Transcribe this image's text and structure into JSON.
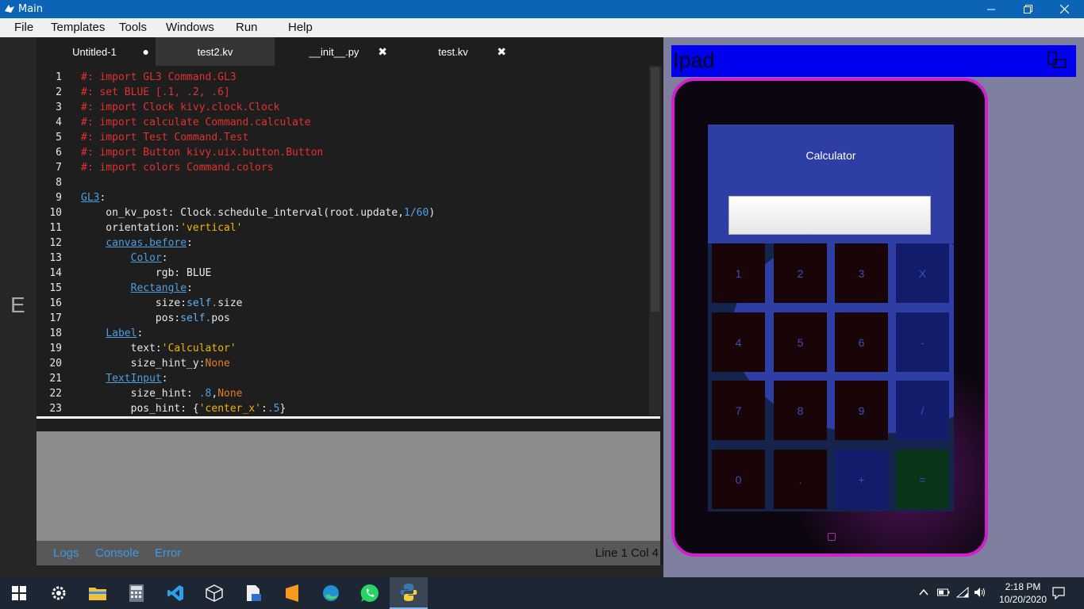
{
  "window": {
    "title": "Main"
  },
  "menu": {
    "items": [
      "File",
      "Templates",
      "Tools",
      "Windows",
      "Run",
      "Help"
    ]
  },
  "tabs": [
    {
      "label": "Untitled-1",
      "mark": "●"
    },
    {
      "label": "test2.kv",
      "mark": ""
    },
    {
      "label": "__init__.py",
      "mark": "✖"
    },
    {
      "label": "test.kv",
      "mark": "✖"
    }
  ],
  "left_strip_letter": "E",
  "code": {
    "line_numbers": [
      "1",
      "2",
      "3",
      "4",
      "5",
      "6",
      "7",
      "8",
      "9",
      "10",
      "11",
      "12",
      "13",
      "14",
      "15",
      "16",
      "17",
      "18",
      "19",
      "20",
      "21",
      "22",
      "23"
    ],
    "lines": [
      [
        [
          "comment",
          "#: import GL3 Command.GL3"
        ]
      ],
      [
        [
          "comment",
          "#: set BLUE [.1, .2, .6]"
        ]
      ],
      [
        [
          "comment",
          "#: import Clock kivy.clock.Clock"
        ]
      ],
      [
        [
          "comment",
          "#: import calculate Command.calculate"
        ]
      ],
      [
        [
          "comment",
          "#: import Test Command.Test"
        ]
      ],
      [
        [
          "comment",
          "#: import Button kivy.uix.button.Button"
        ]
      ],
      [
        [
          "comment",
          "#: import colors Command.colors"
        ]
      ],
      [],
      [
        [
          "link",
          "GL3"
        ],
        [
          "plain",
          ":"
        ]
      ],
      [
        [
          "plain",
          "    on_kv_post: Clock"
        ],
        [
          "dot",
          "."
        ],
        [
          "plain",
          "schedule_interval(root"
        ],
        [
          "dot",
          "."
        ],
        [
          "plain",
          "update,"
        ],
        [
          "num",
          "1"
        ],
        [
          "dot",
          "/"
        ],
        [
          "num",
          "60"
        ],
        [
          "plain",
          ")"
        ]
      ],
      [
        [
          "plain",
          "    orientation:"
        ],
        [
          "str",
          "'vertical'"
        ]
      ],
      [
        [
          "plain",
          "    "
        ],
        [
          "link",
          "canvas.before"
        ],
        [
          "plain",
          ":"
        ]
      ],
      [
        [
          "plain",
          "        "
        ],
        [
          "link",
          "Color"
        ],
        [
          "plain",
          ":"
        ]
      ],
      [
        [
          "plain",
          "            rgb: BLUE"
        ]
      ],
      [
        [
          "plain",
          "        "
        ],
        [
          "link",
          "Rectangle"
        ],
        [
          "plain",
          ":"
        ]
      ],
      [
        [
          "plain",
          "            size:"
        ],
        [
          "kw",
          "self"
        ],
        [
          "dot",
          "."
        ],
        [
          "plain",
          "size"
        ]
      ],
      [
        [
          "plain",
          "            pos:"
        ],
        [
          "kw",
          "self"
        ],
        [
          "dot",
          "."
        ],
        [
          "plain",
          "pos"
        ]
      ],
      [
        [
          "plain",
          "    "
        ],
        [
          "link",
          "Label"
        ],
        [
          "plain",
          ":"
        ]
      ],
      [
        [
          "plain",
          "        text:"
        ],
        [
          "str",
          "'Calculator'"
        ]
      ],
      [
        [
          "plain",
          "        size_hint_y:"
        ],
        [
          "const",
          "None"
        ]
      ],
      [
        [
          "plain",
          "    "
        ],
        [
          "link",
          "TextInput"
        ],
        [
          "plain",
          ":"
        ]
      ],
      [
        [
          "plain",
          "        size_hint: "
        ],
        [
          "num",
          ".8"
        ],
        [
          "plain",
          ","
        ],
        [
          "const",
          "None"
        ]
      ],
      [
        [
          "plain",
          "        pos_hint: {"
        ],
        [
          "str",
          "'center_x'"
        ],
        [
          "plain",
          ":"
        ],
        [
          "num",
          ".5"
        ],
        [
          "plain",
          "}"
        ]
      ]
    ]
  },
  "bottom_tabs": [
    "Logs",
    "Console",
    "Error"
  ],
  "cursor_position": "Line  1  Col 4",
  "preview": {
    "header_title": "Ipad",
    "calculator_title": "Calculator",
    "display_value": "",
    "keys": [
      "1",
      "2",
      "3",
      "X",
      "4",
      "5",
      "6",
      "-",
      "7",
      "8",
      "9",
      "/",
      "0",
      ".",
      "+",
      "="
    ]
  },
  "clock": {
    "time": "2:18 PM",
    "date": "10/20/2020"
  },
  "colors": {
    "titlebar": "#0b64b5",
    "ipad_header": "#0000ee",
    "device_border": "#d21fcd",
    "calc_blue": "#2f3ea4"
  },
  "taskbar_icons": [
    "start-icon",
    "settings-icon",
    "file-explorer-icon",
    "calculator-icon",
    "vscode-icon",
    "box-icon",
    "document-icon",
    "sublime-icon",
    "edge-icon",
    "whatsapp-icon",
    "python-icon"
  ],
  "tray_icons": [
    "chevron-up-icon",
    "battery-icon",
    "wifi-icon",
    "volume-icon",
    "notification-icon"
  ]
}
